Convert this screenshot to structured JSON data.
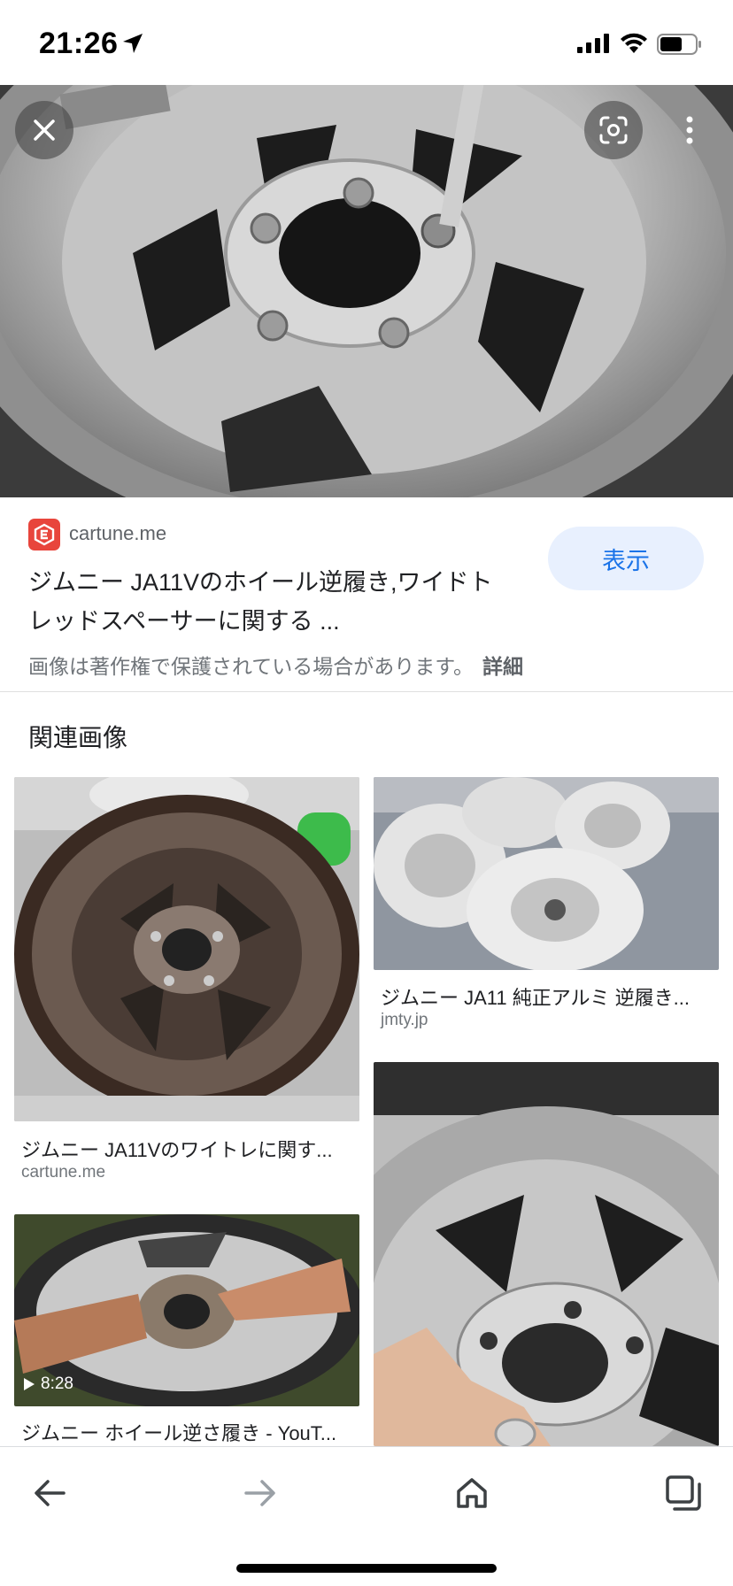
{
  "status": {
    "time": "21:26"
  },
  "source": {
    "site": "cartune.me",
    "title_line1": "ジムニー JA11Vのホイール逆履き,ワイドト",
    "title_line2": "レッドスペーサーに関する ...",
    "view_label": "表示",
    "copyright": "画像は著作権で保護されている場合があります。",
    "detail_label": "詳細"
  },
  "related": {
    "heading": "関連画像",
    "items": [
      {
        "caption": "ジムニー JA11Vのワイトレに関す...",
        "domain": "cartune.me"
      },
      {
        "caption": "ジムニー JA11 純正アルミ 逆履き...",
        "domain": "jmty.jp"
      },
      {
        "caption": "ジムニー ホイール逆さ履き - YouT...",
        "domain": "",
        "duration": "8:28"
      },
      {
        "caption": "",
        "domain": ""
      }
    ]
  },
  "nav": {
    "back": "back-icon",
    "forward": "forward-icon",
    "home": "home-icon",
    "tabs": "tabs-icon"
  }
}
